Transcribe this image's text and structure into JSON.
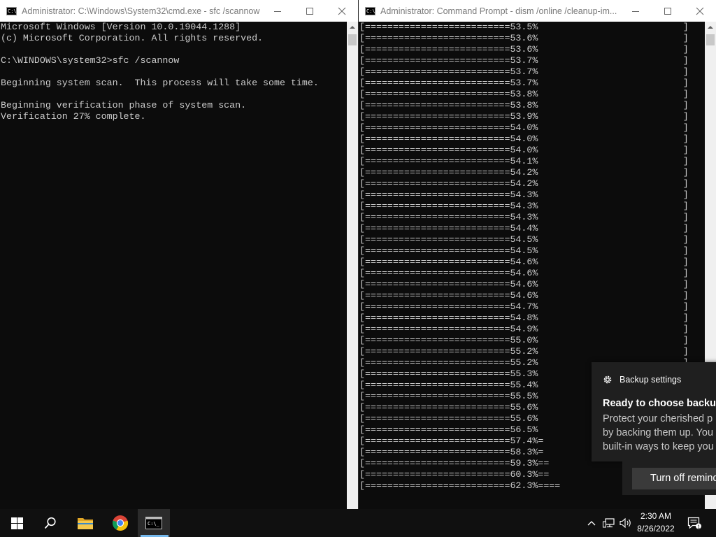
{
  "left_window": {
    "title": "Administrator: C:\\Windows\\System32\\cmd.exe - sfc  /scannow",
    "icon": "cmd-icon",
    "lines": [
      "Microsoft Windows [Version 10.0.19044.1288]",
      "(c) Microsoft Corporation. All rights reserved.",
      "",
      "C:\\WINDOWS\\system32>sfc /scannow",
      "",
      "Beginning system scan.  This process will take some time.",
      "",
      "Beginning verification phase of system scan.",
      "Verification 27% complete."
    ]
  },
  "right_window": {
    "title": "Administrator: Command Prompt - dism  /online /cleanup-im...",
    "icon": "cmd-icon",
    "lines": [
      "[==========================53.5%                          ]",
      "[==========================53.6%                          ]",
      "[==========================53.6%                          ]",
      "[==========================53.7%                          ]",
      "[==========================53.7%                          ]",
      "[==========================53.7%                          ]",
      "[==========================53.8%                          ]",
      "[==========================53.8%                          ]",
      "[==========================53.9%                          ]",
      "[==========================54.0%                          ]",
      "[==========================54.0%                          ]",
      "[==========================54.0%                          ]",
      "[==========================54.1%                          ]",
      "[==========================54.2%                          ]",
      "[==========================54.2%                          ]",
      "[==========================54.3%                          ]",
      "[==========================54.3%                          ]",
      "[==========================54.3%                          ]",
      "[==========================54.4%                          ]",
      "[==========================54.5%                          ]",
      "[==========================54.5%                          ]",
      "[==========================54.6%                          ]",
      "[==========================54.6%                          ]",
      "[==========================54.6%                          ]",
      "[==========================54.6%                          ]",
      "[==========================54.7%                          ]",
      "[==========================54.8%                          ]",
      "[==========================54.9%                          ]",
      "[==========================55.0%                          ]",
      "[==========================55.2%                          ]",
      "[==========================55.2%                          ]",
      "[==========================55.3%                          ]",
      "[==========================55.4%                          ]",
      "[==========================55.5%                          ]",
      "[==========================55.6%                          ]",
      "[==========================55.6%                          ]",
      "[==========================56.5%                          ]",
      "[==========================57.4%=",
      "[==========================58.3%=",
      "[==========================59.3%==",
      "[==========================60.3%==",
      "[==========================62.3%===="
    ]
  },
  "toast": {
    "header": "Backup settings",
    "title": "Ready to choose backup",
    "body_lines": [
      "Protect your cherished p",
      "by backing them up. You",
      "built-in ways to keep you"
    ],
    "button": "Turn off remind"
  },
  "taskbar": {
    "items": [
      {
        "name": "start-button",
        "icon": "windows-logo-icon"
      },
      {
        "name": "search-button",
        "icon": "search-icon"
      },
      {
        "name": "file-explorer-button",
        "icon": "folder-icon"
      },
      {
        "name": "chrome-button",
        "icon": "chrome-icon"
      },
      {
        "name": "command-prompt-taskbar-button",
        "icon": "cmd-icon"
      }
    ],
    "time": "2:30 AM",
    "date": "8/26/2022"
  }
}
